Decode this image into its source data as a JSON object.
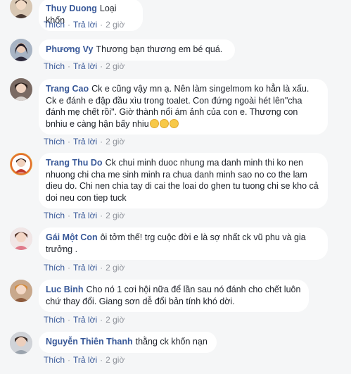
{
  "actions": {
    "like": "Thích",
    "reply": "Trả lời",
    "sep": "·"
  },
  "comments": [
    {
      "author": "Thuy Duong",
      "text": "Loại khốn",
      "time": "2 giờ"
    },
    {
      "author": "Phương Vy",
      "text": "Thương bạn thương em bé quá.",
      "time": "2 giờ"
    },
    {
      "author": "Trang Cao",
      "text": "Ck e cũng vậy mn ạ. Nên làm singelmom ko hẳn là xấu. Ck e đánh e đập đầu xìu trong toalet. Con đứng ngoài hét lên\"cha đánh mẹ chết rồi\". Giờ thành nổi ám ảnh của con e. Thương con bnhiu e càng hận bấy nhiu",
      "emoji_count": 3,
      "time": "2 giờ"
    },
    {
      "author": "Trang Thu Do",
      "text": "Ck chui minh duoc nhung ma danh minh thi ko nen nhuong chi cha me sinh minh ra chua danh minh sao no co the lam dieu do. Chi nen chia tay di cai the loai do ghen tu tuong chi se kho cả doi neu con tiep tuck",
      "time": "2 giờ"
    },
    {
      "author": "Gái Một Con",
      "text": "ôi tởm thế! trg cuộc đời e là sợ nhất ck vũ phu và gia trưởng .",
      "time": "2 giờ"
    },
    {
      "author": "Luc Binh",
      "text": "Cho nó 1 cơi hội nữa để lần sau nó đánh cho chết luôn chứ thay đổi. Giang sơn dễ đổi bản tính khó dời.",
      "time": "2 giờ"
    },
    {
      "author": "Nguyễn Thiên Thanh",
      "text": "thằng ck khốn nạn",
      "time": "2 giờ"
    }
  ],
  "colors": {
    "link": "#385898",
    "meta": "#90949c",
    "bubble": "#ffffff",
    "background": "#f5f6f7"
  }
}
